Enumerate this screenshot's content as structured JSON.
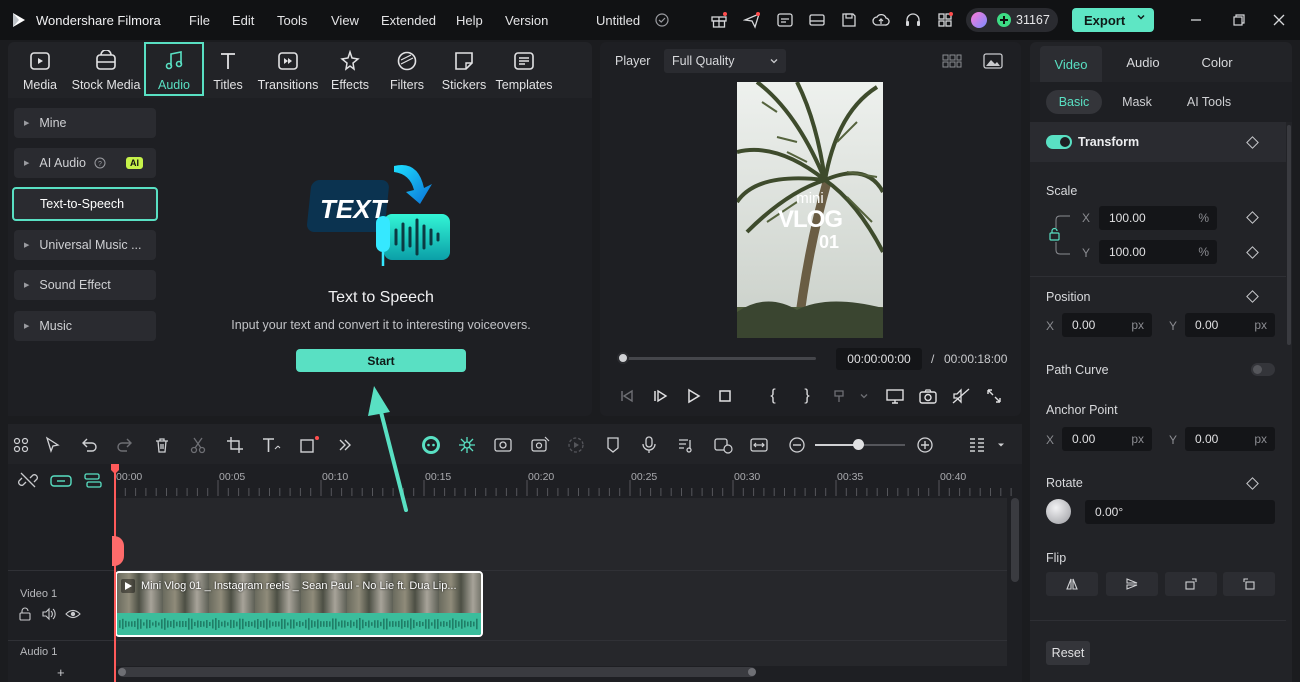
{
  "app": {
    "name": "Wondershare Filmora",
    "project_title": "Untitled",
    "credits": "31167",
    "export_label": "Export"
  },
  "menu": [
    "File",
    "Edit",
    "Tools",
    "View",
    "Extended",
    "Help",
    "Version"
  ],
  "media_tabs": [
    {
      "label": "Media",
      "icon": "media-icon"
    },
    {
      "label": "Stock Media",
      "icon": "stock-media-icon"
    },
    {
      "label": "Audio",
      "icon": "music-note-icon",
      "active": true
    },
    {
      "label": "Titles",
      "icon": "titles-icon"
    },
    {
      "label": "Transitions",
      "icon": "transitions-icon"
    },
    {
      "label": "Effects",
      "icon": "effects-icon"
    },
    {
      "label": "Filters",
      "icon": "filters-icon"
    },
    {
      "label": "Stickers",
      "icon": "stickers-icon"
    },
    {
      "label": "Templates",
      "icon": "templates-icon"
    }
  ],
  "sidebar": {
    "items": [
      {
        "label": "Mine"
      },
      {
        "label": "AI Audio",
        "badge": "AI"
      },
      {
        "label": "Text-to-Speech",
        "active": true
      },
      {
        "label": "Universal Music ..."
      },
      {
        "label": "Sound Effect"
      },
      {
        "label": "Music"
      }
    ]
  },
  "tts": {
    "graphic_word": "TEXT",
    "title": "Text to Speech",
    "description": "Input your text and convert it to interesting voiceovers.",
    "start_label": "Start"
  },
  "player": {
    "label": "Player",
    "quality": "Full Quality",
    "video_text_small": "mini",
    "video_text_big": "VLOG",
    "video_text_num": "01",
    "current_time": "00:00:00:00",
    "separator": "/",
    "total_time": "00:00:18:00"
  },
  "props": {
    "tabs": [
      "Video",
      "Audio",
      "Color"
    ],
    "subtabs": [
      "Basic",
      "Mask",
      "AI Tools"
    ],
    "transform_label": "Transform",
    "scale_label": "Scale",
    "scale_x": "100.00",
    "scale_y": "100.00",
    "percent_unit": "%",
    "position_label": "Position",
    "pos_x": "0.00",
    "pos_y": "0.00",
    "px_unit": "px",
    "path_curve_label": "Path Curve",
    "anchor_label": "Anchor Point",
    "anchor_x": "0.00",
    "anchor_y": "0.00",
    "rotate_label": "Rotate",
    "rotate_value": "0.00°",
    "flip_label": "Flip",
    "reset_label": "Reset",
    "x_label": "X",
    "y_label": "Y"
  },
  "timeline": {
    "ticks": [
      "00:00",
      "00:05",
      "00:10",
      "00:15",
      "00:20",
      "00:25",
      "00:30",
      "00:35",
      "00:40"
    ],
    "video_track_label": "Video 1",
    "audio_track_label": "Audio 1",
    "clip_title": "Mini Vlog 01 _ Instagram reels _ Sean Paul - No Lie ft. Dua Lip...",
    "add_track": "+"
  },
  "colors": {
    "accent": "#59e0c3",
    "export": "#5ee6c4",
    "playhead": "#ff5a5a"
  }
}
